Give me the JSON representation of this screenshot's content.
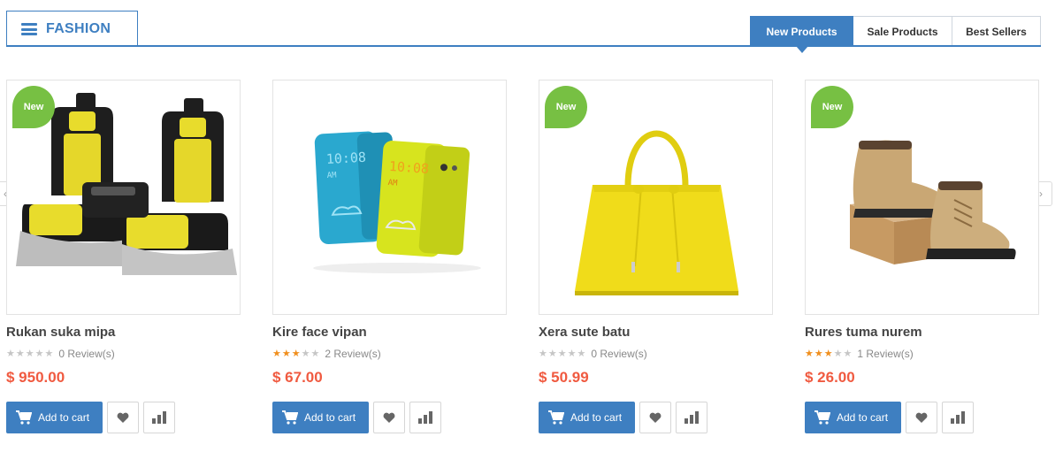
{
  "header": {
    "category_title": "FASHION",
    "menu_icon": "hamburger-icon",
    "accent_color": "#3e7fc1",
    "tabs": [
      {
        "label": "New Products",
        "active": true
      },
      {
        "label": "Sale Products",
        "active": false
      },
      {
        "label": "Best Sellers",
        "active": false
      }
    ]
  },
  "carousel": {
    "prev_icon": "chevron-left-icon",
    "next_icon": "chevron-right-icon",
    "prev_glyph": "‹",
    "next_glyph": "›"
  },
  "products": [
    {
      "name": "Rukan suka mipa",
      "badge": "New",
      "rating": 0,
      "reviews": "0 Review(s)",
      "price": "$ 950.00",
      "image": "car-seat-covers-image",
      "cart_label": "Add to cart"
    },
    {
      "name": "Kire face vipan",
      "badge": "",
      "rating": 3,
      "reviews": "2 Review(s)",
      "price": "$ 67.00",
      "image": "phone-flip-cases-image",
      "cart_label": "Add to cart"
    },
    {
      "name": "Xera sute batu",
      "badge": "New",
      "rating": 0,
      "reviews": "0 Review(s)",
      "price": "$ 50.99",
      "image": "yellow-handbag-image",
      "cart_label": "Add to cart"
    },
    {
      "name": "Rures tuma nurem",
      "badge": "New",
      "rating": 3,
      "reviews": "1 Review(s)",
      "price": "$ 26.00",
      "image": "boots-and-box-image",
      "cart_label": "Add to cart"
    }
  ],
  "colors": {
    "badge_new": "#77c043",
    "price": "#f05a40",
    "star_on": "#f08f1e",
    "star_off": "#c6c6c6"
  }
}
